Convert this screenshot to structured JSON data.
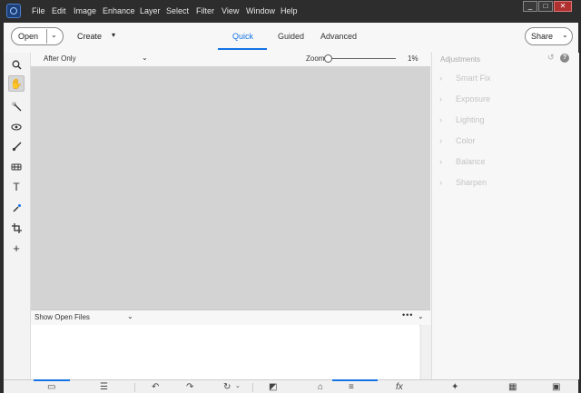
{
  "menu": [
    "File",
    "Edit",
    "Image",
    "Enhance",
    "Layer",
    "Select",
    "Filter",
    "View",
    "Window",
    "Help"
  ],
  "window_controls": {
    "minimize": "_",
    "maximize": "□",
    "close": "✕"
  },
  "toolbar": {
    "open_label": "Open",
    "create_label": "Create",
    "share_label": "Share",
    "tabs": [
      {
        "label": "Quick"
      },
      {
        "label": "Guided"
      },
      {
        "label": "Advanced"
      }
    ],
    "active_tab": "Quick"
  },
  "tools": [
    "zoom",
    "hand",
    "quick-selection",
    "red-eye",
    "whiten-teeth",
    "straighten",
    "text",
    "spot-healing",
    "crop",
    "move"
  ],
  "view_options": {
    "view_label": "After Only",
    "zoom_label": "Zoom",
    "zoom_value": "1%"
  },
  "photo_bin": {
    "label": "Show Open Files",
    "more": "•••"
  },
  "adjustments": {
    "title": "Adjustments",
    "items": [
      {
        "label": "Smart Fix"
      },
      {
        "label": "Exposure"
      },
      {
        "label": "Lighting"
      },
      {
        "label": "Color"
      },
      {
        "label": "Balance"
      },
      {
        "label": "Sharpen"
      }
    ]
  },
  "colors": {
    "accent": "#1473e6",
    "canvas": "#d3d3d3",
    "menubar": "#2d2d2d"
  }
}
